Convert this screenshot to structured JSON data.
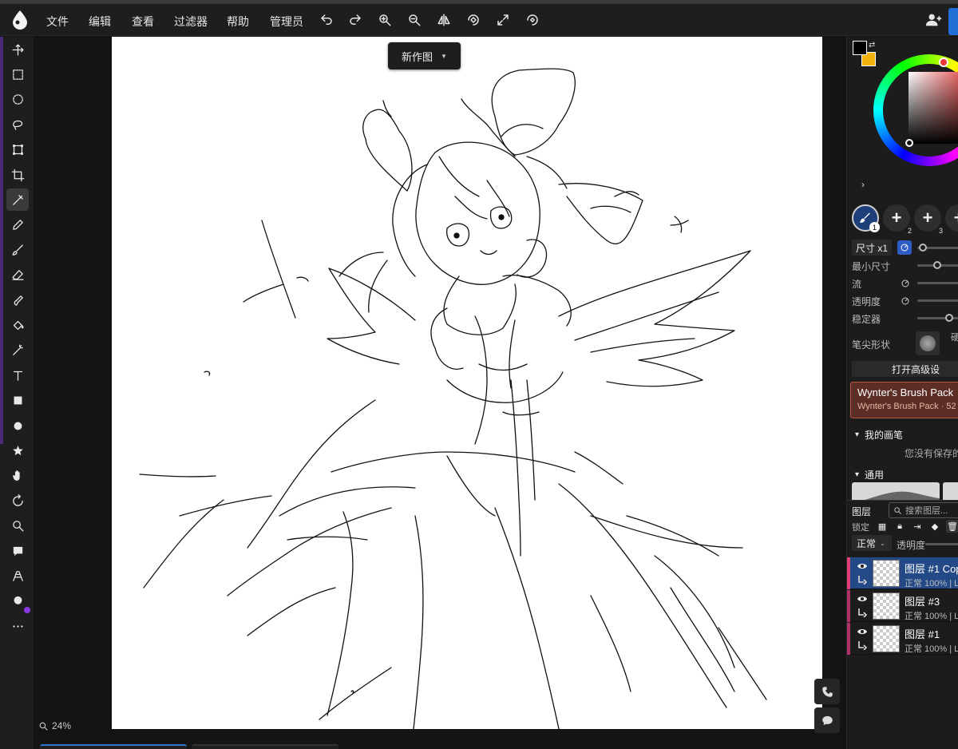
{
  "menu": [
    "文件",
    "编辑",
    "查看",
    "过滤器",
    "帮助",
    "管理员"
  ],
  "topbar_icons": [
    "undo-icon",
    "redo-icon",
    "zoom-in-icon",
    "zoom-out-icon",
    "flip-icon",
    "rotate-icon",
    "fullscreen-icon",
    "reset-rotation-icon"
  ],
  "document": {
    "name": "新作图"
  },
  "zoom": "24%",
  "tools": [
    "move-icon",
    "rect-select-icon",
    "ellipse-select-icon",
    "lasso-icon",
    "transform-icon",
    "crop-icon",
    "eyedropper-icon",
    "pencil-icon",
    "brush-icon",
    "eraser-icon",
    "smudge-icon",
    "fill-icon",
    "magic-wand-icon",
    "text-icon",
    "rectangle-icon",
    "ellipse-icon",
    "star-icon",
    "hand-icon",
    "rotate-view-icon",
    "zoom-icon",
    "comment-icon",
    "perspective-icon",
    "blur-icon",
    "more-icon"
  ],
  "colors": {
    "primary": "#000000",
    "secondary": "#f0b20f",
    "accent_blue": "#1f6fd6",
    "pack_bg": "#5c2e26"
  },
  "brush": {
    "slots": [
      {
        "label": "1"
      },
      {
        "label": "2"
      },
      {
        "label": "3"
      },
      {
        "label": ""
      }
    ],
    "size_label": "尺寸 x1",
    "min_size_label": "最小尺寸",
    "flow_label": "流",
    "opacity_label": "透明度",
    "stabilizer_label": "稳定器",
    "tip_label": "笔尖形状",
    "hardness_label": "硬",
    "advanced_label": "打开高级设"
  },
  "brush_pack": {
    "title": "Wynter's Brush Pack",
    "subtitle": "Wynter's Brush Pack · 52"
  },
  "sections": {
    "my_brushes": "我的画笔",
    "my_brushes_empty": "您没有保存的",
    "general": "通用"
  },
  "layers": {
    "title": "图层",
    "search_placeholder": "搜索图层...",
    "lock_label": "锁定",
    "blend_mode": "正常",
    "opacity_label": "透明度",
    "items": [
      {
        "name": "图层 #1 Cop",
        "meta": "正常 100% | L",
        "color": "#e0407a",
        "selected": true
      },
      {
        "name": "图层 #3",
        "meta": "正常 100% | L",
        "color": "#b0306a",
        "selected": false
      },
      {
        "name": "图层 #1",
        "meta": "正常 100% | L",
        "color": "#b0306a",
        "selected": false
      }
    ]
  }
}
